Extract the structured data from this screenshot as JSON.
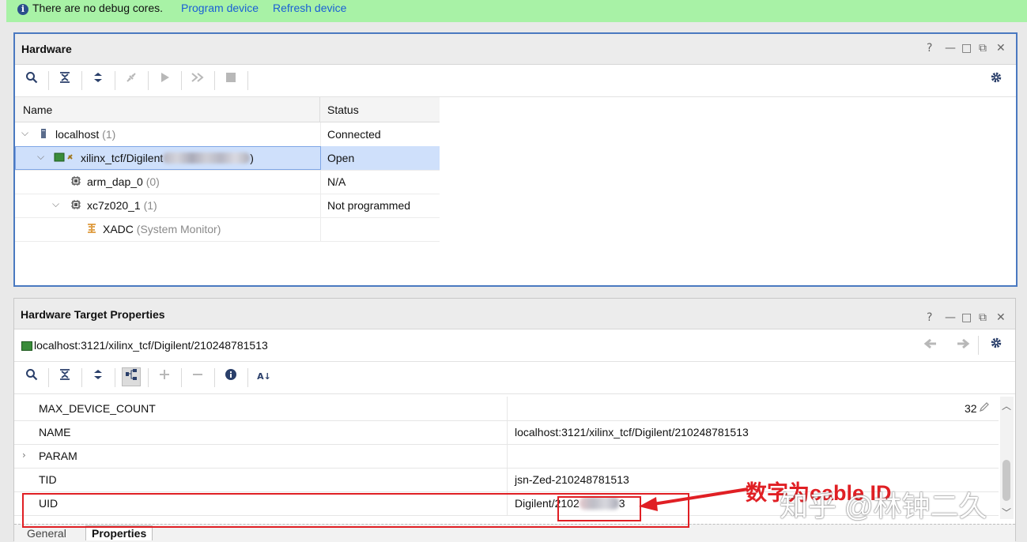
{
  "banner": {
    "message": "There are no debug cores.",
    "link_program": "Program device",
    "link_refresh": "Refresh device",
    "icon": "info-icon"
  },
  "hardware": {
    "title": "Hardware",
    "window_controls": [
      "?",
      "—",
      "□",
      "⧉",
      "✕"
    ],
    "toolbar_icons": [
      "search-icon",
      "collapse-all-icon",
      "expand-all-icon",
      "auto-connect-icon",
      "run-icon",
      "run-all-icon",
      "stop-icon",
      "gear-icon"
    ],
    "columns": {
      "name": "Name",
      "status": "Status"
    },
    "rows": [
      {
        "name": "localhost",
        "count": "(1)",
        "status": "Connected"
      },
      {
        "name": "xilinx_tcf/Digilent",
        "suffix": ")",
        "status": "Open"
      },
      {
        "name": "arm_dap_0",
        "count": "(0)",
        "status": "N/A"
      },
      {
        "name": "xc7z020_1",
        "count": "(1)",
        "status": "Not programmed"
      },
      {
        "name": "XADC",
        "count": "(System Monitor)",
        "status": ""
      }
    ]
  },
  "target_properties": {
    "title": "Hardware Target Properties",
    "path": "localhost:3121/xilinx_tcf/Digilent/210248781513",
    "props": [
      {
        "key": "MAX_DEVICE_COUNT",
        "value": "32"
      },
      {
        "key": "NAME",
        "value": "localhost:3121/xilinx_tcf/Digilent/210248781513"
      },
      {
        "key": "PARAM",
        "value": ""
      },
      {
        "key": "TID",
        "value": "jsn-Zed-210248781513"
      },
      {
        "key": "UID",
        "value_prefix": "Digilent/2102",
        "value_suffix": "3"
      }
    ],
    "tabs": [
      "General",
      "Properties"
    ],
    "active_tab": "Properties"
  },
  "annotation": {
    "text": "数字为cable ID",
    "color": "#e01f24"
  },
  "watermark": "知乎 @林钟二久"
}
